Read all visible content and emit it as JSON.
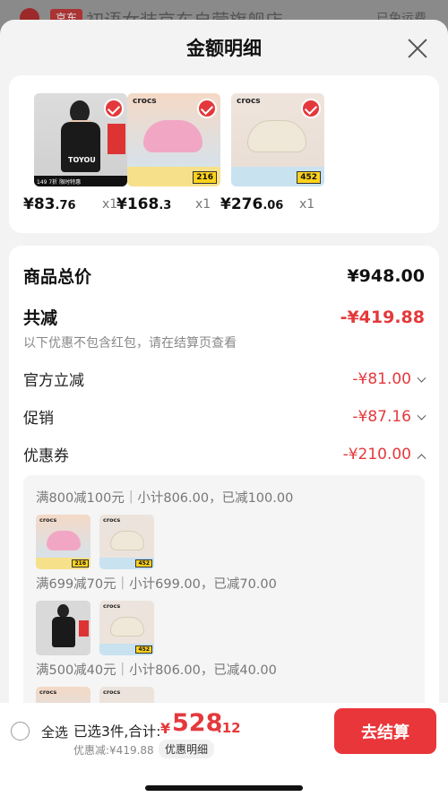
{
  "background": {
    "store_tag": "京东",
    "store_title": "初语女装京东自营旗舰店",
    "right_text": "已免运费"
  },
  "sheet": {
    "title": "金额明细"
  },
  "products": [
    {
      "price_int": "¥83",
      "price_dec": ".76",
      "qty": "x1",
      "thumb": "model",
      "brand": "TOYOU",
      "strip": "149 7折 限时特惠"
    },
    {
      "price_int": "¥168",
      "price_dec": ".3",
      "qty": "x1",
      "thumb": "crocs-pink",
      "logo": "crocs",
      "badge": "216"
    },
    {
      "price_int": "¥276",
      "price_dec": ".06",
      "qty": "x1",
      "thumb": "crocs-cream",
      "logo": "crocs",
      "badge": "452"
    }
  ],
  "summary": {
    "total_label": "商品总价",
    "total_value": "¥948.00",
    "reduce_label": "共减",
    "reduce_value": "-¥419.88",
    "note": "以下优惠不包含红包，请在结算页查看",
    "official_label": "官方立减",
    "official_value": "-¥81.00",
    "promo_label": "促销",
    "promo_value": "-¥87.16",
    "coupon_label": "优惠券",
    "coupon_value": "-¥210.00"
  },
  "coupons": [
    {
      "text": "满800减100元｜小计806.00，已减100.00",
      "thumbs": [
        "crocs-pink",
        "crocs-cream"
      ]
    },
    {
      "text": "满699减70元｜小计699.00，已减70.00",
      "thumbs": [
        "model",
        "crocs-cream"
      ]
    },
    {
      "text": "满500减40元｜小计806.00，已减40.00",
      "thumbs": [
        "crocs-pink",
        "crocs-cream"
      ]
    }
  ],
  "mini_badges": {
    "pink": "216",
    "cream": "452"
  },
  "bottom": {
    "select_all": "全选",
    "selected": "已选3件,合计:",
    "total_symbol": "¥",
    "total_int": "528",
    "total_dec": ".12",
    "discount": "优惠减:¥419.88",
    "detail_chip": "优惠明细",
    "checkout": "去结算"
  },
  "colors": {
    "accent": "#e4393c",
    "checkout_bg": "#e9363a"
  }
}
